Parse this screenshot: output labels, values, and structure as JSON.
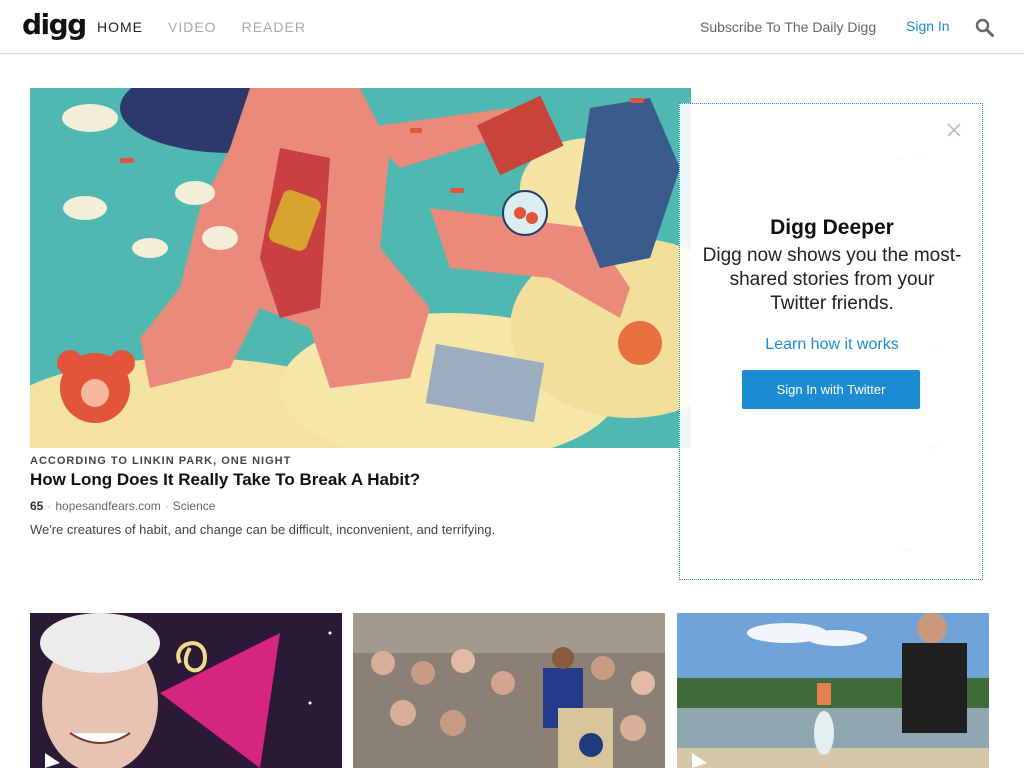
{
  "header": {
    "logo": "digg",
    "nav": [
      {
        "label": "HOME",
        "active": true
      },
      {
        "label": "VIDEO",
        "active": false
      },
      {
        "label": "READER",
        "active": false
      }
    ],
    "subscribe": "Subscribe To The Daily Digg",
    "signin": "Sign In",
    "search_icon": "search-icon"
  },
  "hero": {
    "kicker": "ACCORDING TO LINKIN PARK, ONE NIGHT",
    "title": "How Long Does It Really Take To Break A Habit?",
    "score": "65",
    "source": "hopesandfears.com",
    "category": "Science",
    "description": "We're creatures of habit, and change can be difficult, inconvenient, and terrifying."
  },
  "deeper": {
    "title": "Digg Deeper",
    "body": "Digg now shows you the most-shared stories from your Twitter friends.",
    "learn": "Learn how it works",
    "button": "Sign In with Twitter",
    "close_icon": "close-icon"
  },
  "colors": {
    "accent": "#1b8cd4",
    "hero_bg": "#4fb8b0"
  }
}
